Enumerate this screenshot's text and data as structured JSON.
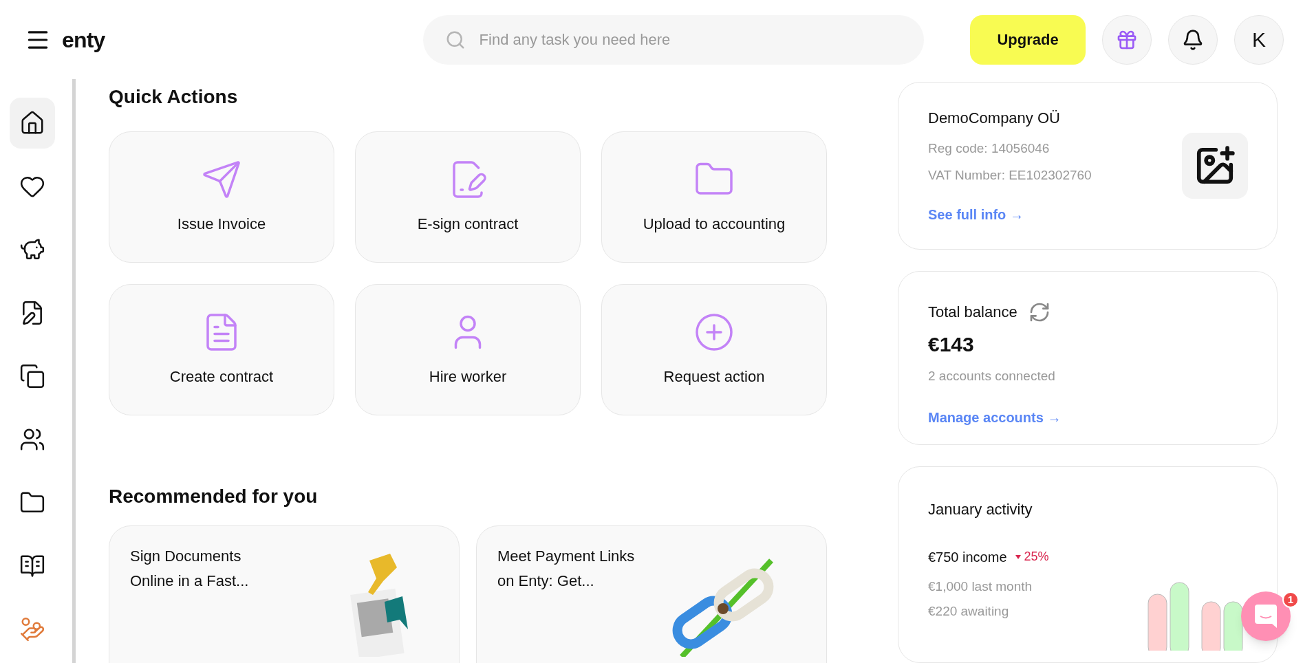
{
  "header": {
    "logo": "enty",
    "search": {
      "placeholder": "Find any task you need here"
    },
    "upgrade": "Upgrade",
    "avatar": "K"
  },
  "sidebar": {
    "items": [
      {
        "kind": "home",
        "selected": true
      },
      {
        "kind": "heart",
        "selected": false
      },
      {
        "kind": "piggy",
        "selected": false
      },
      {
        "kind": "receipt",
        "selected": false
      },
      {
        "kind": "copy",
        "selected": false
      },
      {
        "kind": "users",
        "selected": false
      },
      {
        "kind": "folder",
        "selected": false
      },
      {
        "kind": "book",
        "selected": false
      },
      {
        "kind": "coins",
        "selected": false
      }
    ]
  },
  "quick_actions": {
    "title": "Quick Actions",
    "items": [
      {
        "kind": "send",
        "label": "Issue Invoice"
      },
      {
        "kind": "sign",
        "label": "E-sign contract"
      },
      {
        "kind": "folder",
        "label": "Upload to accounting"
      },
      {
        "kind": "document",
        "label": "Create contract"
      },
      {
        "kind": "person",
        "label": "Hire worker"
      },
      {
        "kind": "plus",
        "label": "Request action"
      }
    ]
  },
  "recommended": {
    "title": "Recommended for you",
    "items": [
      {
        "kind": "hand",
        "lines": [
          "Sign Documents",
          "Online in a Fast..."
        ]
      },
      {
        "kind": "chain",
        "lines": [
          "Meet Payment Links",
          "on Enty: Get..."
        ]
      }
    ]
  },
  "company": {
    "name": "DemoCompany OÜ",
    "reg_code": "Reg code: 14056046",
    "vat": "VAT Number: EE102302760",
    "link": "See full info →"
  },
  "balance": {
    "title": "Total balance",
    "amount": "€143",
    "accounts": "2 accounts connected",
    "link": "Manage accounts →"
  },
  "activity": {
    "title": "January activity",
    "income": "€750 income",
    "change": "25%",
    "last_month": "€1,000 last month",
    "awaiting": "€220 awaiting"
  },
  "chat": {
    "badge": "1"
  }
}
